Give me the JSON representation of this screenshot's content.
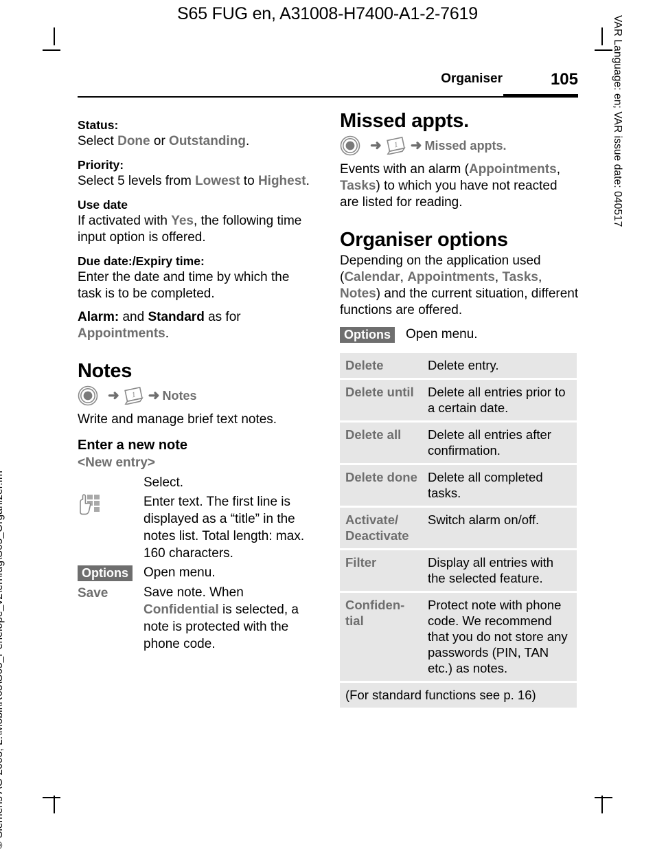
{
  "document": {
    "running_head": "S65 FUG en, A31008-H7400-A1-2-7619",
    "margin_right": "VAR Language: en; VAR issue date: 040517",
    "margin_left": "© Siemens AG 2003, L:\\Mobil\\R65\\S65_Penelope_v2\\en\\fug\\S65_Organizer.fm"
  },
  "page_header": {
    "chapter": "Organiser",
    "page_number": "105"
  },
  "left_column": {
    "status": {
      "heading": "Status:",
      "text_before": "Select ",
      "term1": "Done",
      "text_middle": " or ",
      "term2": "Outstanding",
      "text_after": "."
    },
    "priority": {
      "heading": "Priority:",
      "text_before": "Select 5 levels from ",
      "term1": "Lowest",
      "text_middle": " to ",
      "term2": "Highest",
      "text_after": "."
    },
    "use_date": {
      "heading": "Use date",
      "text_before": "If activated with ",
      "term1": "Yes",
      "text_after": ", the following time input option is offered."
    },
    "due_date": {
      "heading": "Due date:/Expiry time:",
      "text": "Enter the date and time by which the task is to be completed."
    },
    "alarm": {
      "term1": "Alarm:",
      "text_middle1": " and ",
      "term2": "Standard",
      "text_middle2": " as for ",
      "term3": "Appointments",
      "text_after": "."
    },
    "notes": {
      "title": "Notes",
      "nav_joystick": "joystick-icon",
      "nav_arrow": "➜",
      "nav_organiser": "organiser-calendar-icon",
      "nav_label": "Notes",
      "description": "Write and manage brief text notes."
    },
    "enter_new_note": {
      "heading": "Enter a new note",
      "new_entry_label": "<New entry>",
      "rows": [
        {
          "term": "",
          "icon": "",
          "desc": "Select."
        },
        {
          "term": "",
          "icon": "keypad-icon",
          "desc": "Enter text. The first line is displayed as a “title” in the notes list. Total length: max. 160 characters."
        }
      ],
      "options_key": "Options",
      "options_desc": "Open menu.",
      "save_key": "Save",
      "save_desc_before": "Save note. When ",
      "save_desc_term": "Confidential",
      "save_desc_after": " is selected, a note is protected with the phone code."
    }
  },
  "right_column": {
    "missed_appts": {
      "title": "Missed appts.",
      "nav_joystick": "joystick-icon",
      "nav_arrow": "➜",
      "nav_organiser": "organiser-calendar-icon",
      "nav_label": "Missed appts.",
      "desc_before": "Events with an alarm (",
      "desc_term1": "Appointments",
      "desc_sep": ", ",
      "desc_term2": "Tasks",
      "desc_after": ") to which you have not reacted are listed for reading."
    },
    "organiser_options": {
      "title": "Organiser options",
      "desc_before": "Depending on the application used (",
      "terms": [
        "Calendar",
        "Appointments",
        "Tasks",
        "Notes"
      ],
      "desc_after": ") and the current situation, different functions are offered.",
      "options_key": "Options",
      "options_desc": "Open menu.",
      "table": [
        {
          "name": "Delete",
          "desc": "Delete entry."
        },
        {
          "name": "Delete until",
          "desc": "Delete all entries prior to a certain date."
        },
        {
          "name": "Delete all",
          "desc": "Delete all entries after confirmation."
        },
        {
          "name": "Delete done",
          "desc": "Delete all completed tasks."
        },
        {
          "name": "Activate/ Deactivate",
          "desc": "Switch alarm on/off."
        },
        {
          "name": "Filter",
          "desc": "Display all entries with the selected feature."
        },
        {
          "name": "Confiden- tial",
          "desc": "Protect note with phone code. We recommend that you do not store any passwords (PIN, TAN etc.) as notes."
        }
      ],
      "footnote": "(For standard functions see p. 16)"
    }
  },
  "colors": {
    "ui_term_gray": "#6e6e6e",
    "table_row_bg": "#e6e6e6",
    "softkey_bg": "#6e6e6e",
    "text_black": "#000000"
  }
}
